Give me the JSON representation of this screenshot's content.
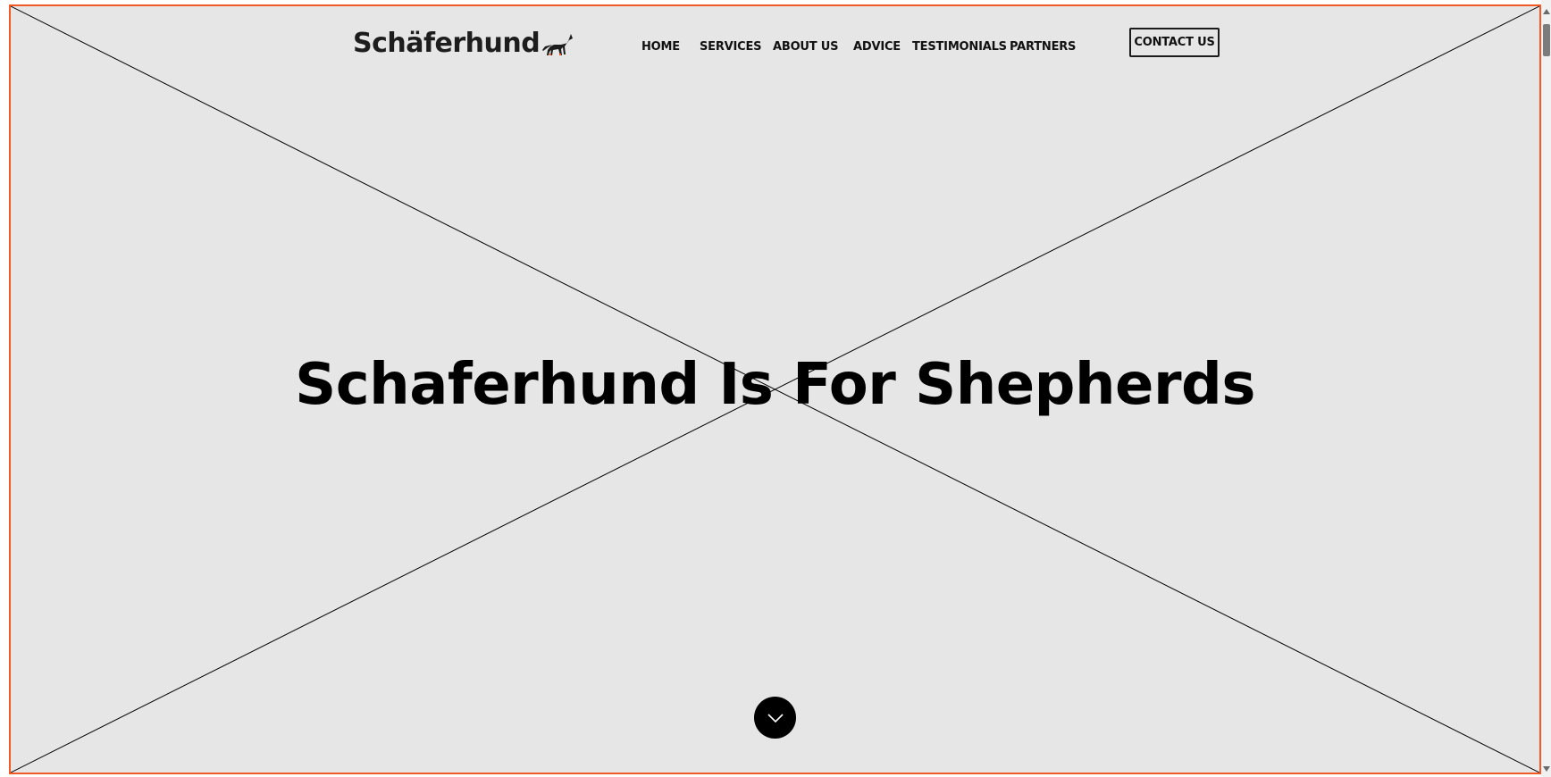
{
  "header": {
    "logo_text": "Schäferhund",
    "logo_icon": "german-shepherd-dog-icon",
    "nav": [
      {
        "label": "HOME"
      },
      {
        "label": "SERVICES"
      },
      {
        "label": "ABOUT US"
      },
      {
        "label": "ADVICE"
      },
      {
        "label": "TESTIMONIALS"
      },
      {
        "label": "PARTNERS"
      }
    ],
    "contact_label": "CONTACT US"
  },
  "hero": {
    "title": "Schaferhund Is For Shepherds",
    "scroll_icon": "chevron-down-icon"
  },
  "colors": {
    "accent": "#f15a24",
    "hero_background": "#e6e6e6",
    "text": "#000000"
  }
}
